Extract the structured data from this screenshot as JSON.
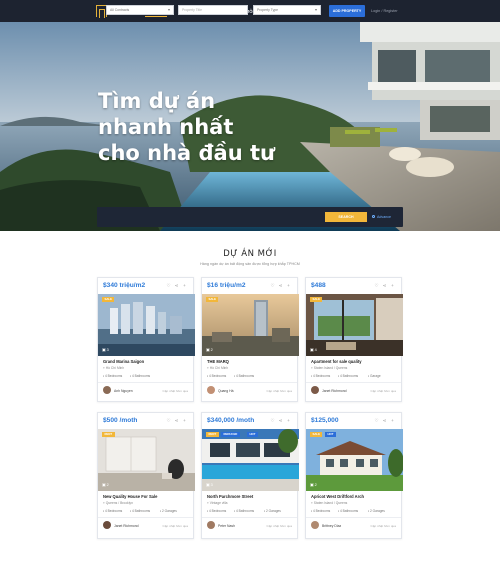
{
  "brand": {
    "logo_text": "NHÀ ĐẤT VIỆT NAM",
    "accent": "#f2b73a",
    "primary": "#2b6ed9"
  },
  "nav": {
    "items": [
      "TRANG CHỦ",
      "GIỚI THIỆU",
      "DỰ ÁN",
      "NHÀ MÔI GIỚI",
      "BLOG",
      "LIÊN HỆ"
    ],
    "active": "TRANG CHỦ",
    "add_property": "ADD PROPERTY",
    "login": "Login / Register"
  },
  "hero": {
    "title_lines": [
      "Tìm dự án",
      "nhanh nhất",
      "cho nhà đầu tư"
    ],
    "search": {
      "type": "All Contracts",
      "title_placeholder": "Property Title",
      "property_type": "Property Type",
      "button": "SEARCH",
      "advance": "Advance"
    }
  },
  "section": {
    "title": "DỰ ÁN MỚI",
    "subtitle": "Hàng ngàn dự án bất động sản được tổng hợp khắp TPHCM"
  },
  "listings": [
    {
      "price": "$340 triệu/m2",
      "tags": [
        "SALE"
      ],
      "photos": "3",
      "title": "Grand Marina Saigon",
      "location": "Hồ Chí Minh",
      "features": [
        "4 Bedrooms",
        "4 Bathrooms"
      ],
      "agent": "Anh Nguyen",
      "time": "Cập nhật hôm qua"
    },
    {
      "price": "$16 triệu/m2",
      "tags": [
        "SALE"
      ],
      "photos": "2",
      "title": "THE MARQ",
      "location": "Hồ Chí Minh",
      "features": [
        "4 Bedrooms",
        "4 Bathrooms"
      ],
      "agent": "Quang Hà",
      "time": "Cập nhật hôm qua"
    },
    {
      "price": "$488",
      "tags": [
        "SALE"
      ],
      "photos": "4",
      "title": "Apartment for sale quality",
      "location": "Staten Island / Queens",
      "features": [
        "4 Bedrooms",
        "4 Bathrooms",
        "Garage"
      ],
      "agent": "Janet Richmond",
      "time": "Cập nhật hôm qua"
    },
    {
      "price": "$500 /moth",
      "tags": [
        "RENT"
      ],
      "photos": "2",
      "title": "New Quality House For Sale",
      "location": "Queens / Brooklyn",
      "features": [
        "4 Bedrooms",
        "4 Bathrooms",
        "2 Garages"
      ],
      "agent": "Janet Richmond",
      "time": "Cập nhật hôm qua"
    },
    {
      "price": "$340,000 /moth",
      "tags": [
        "RENT",
        "REDUCED",
        "HOT"
      ],
      "photos": "3",
      "title": "North Parchmore Street",
      "location": "Vintage villa",
      "features": [
        "4 Bedrooms",
        "4 Bathrooms",
        "2 Garages"
      ],
      "agent": "Peter Nash",
      "time": "Cập nhật hôm qua"
    },
    {
      "price": "$125,000",
      "tags": [
        "SALE",
        "HOT"
      ],
      "photos": "2",
      "title": "Apricot West Driftford Arch",
      "location": "Staten Island / Queens",
      "features": [
        "4 Bedrooms",
        "4 Bathrooms",
        "2 Garages"
      ],
      "agent": "Brittney Diaz",
      "time": "Cập nhật hôm qua"
    }
  ]
}
